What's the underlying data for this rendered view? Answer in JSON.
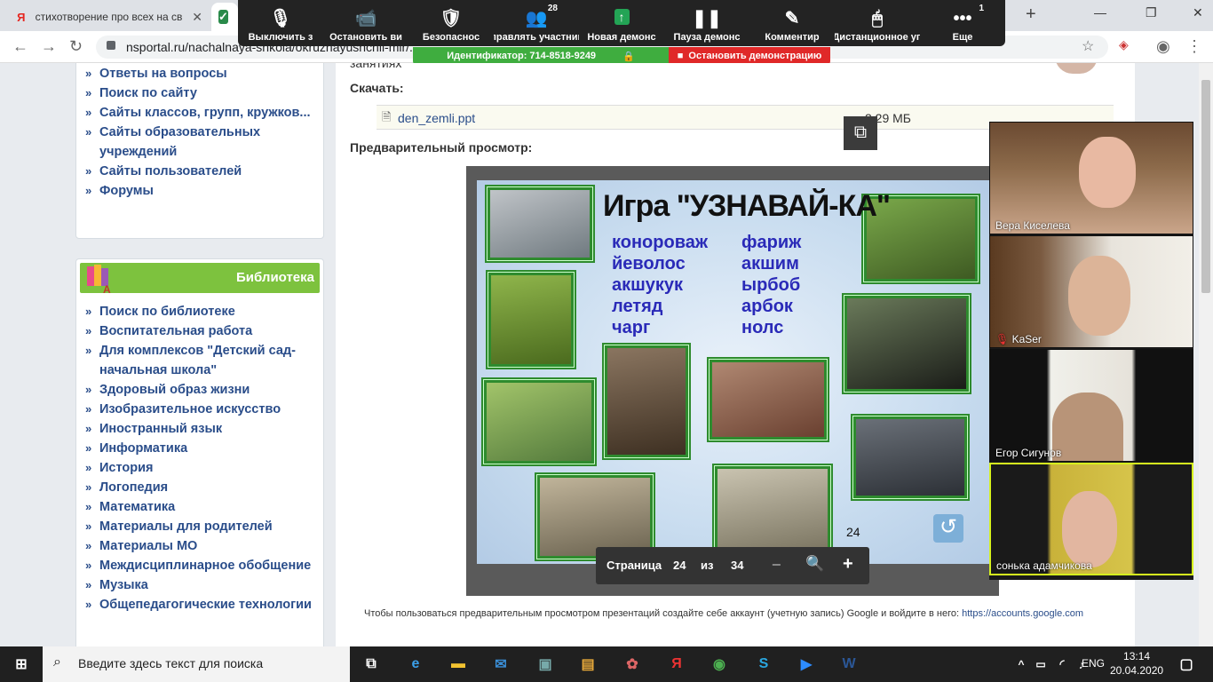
{
  "tabs": [
    {
      "title": "стихотворение про всех на св",
      "favicon": "Я",
      "color": "#e52620"
    },
    {
      "title": "",
      "favicon": "✓",
      "color": "#2a8a4a"
    }
  ],
  "window": {
    "minimize": "—",
    "maximize": "❐",
    "close": "✕",
    "new_tab": "+"
  },
  "address": {
    "url": "nsportal.ru/nachalnaya-shkola/okruzhayushchii-mir/..."
  },
  "zoom": {
    "buttons": [
      {
        "label": "Выключить з",
        "icon": "🎙",
        "badge": ""
      },
      {
        "label": "Остановить ви",
        "icon": "📹",
        "badge": ""
      },
      {
        "label": "Безопаснос",
        "icon": "🛡",
        "badge": ""
      },
      {
        "label": "Управлять участника",
        "icon": "👥",
        "badge": "28"
      },
      {
        "label": "Новая демонс",
        "icon": "↑",
        "badge": ""
      },
      {
        "label": "Пауза демонс",
        "icon": "❚❚",
        "badge": ""
      },
      {
        "label": "Комментир",
        "icon": "✎",
        "badge": ""
      },
      {
        "label": "Дистанционное уп",
        "icon": "🖱",
        "badge": ""
      },
      {
        "label": "Еще",
        "icon": "•••",
        "badge": "1"
      }
    ],
    "meeting_id": "Идентификатор: 714-8518-9249",
    "stop_share": "Остановить демонстрацию"
  },
  "sidebar": {
    "top_items": [
      "Ответы на вопросы",
      "Поиск по сайту",
      "Сайты классов, групп, кружков...",
      "Сайты образовательных учреждений",
      "Сайты пользователей",
      "Форумы"
    ],
    "library_title": "Библиотека",
    "library_items": [
      "Поиск по библиотеке",
      "Воспитательная работа",
      "Для комплексов \"Детский сад-начальная школа\"",
      "Здоровый образ жизни",
      "Изобразительное искусство",
      "Иностранный язык",
      "Информатика",
      "История",
      "Логопедия",
      "Математика",
      "Материалы для родителей",
      "Материалы МО",
      "Междисциплинарное обобщение",
      "Музыка",
      "Общепедагогические технологии"
    ]
  },
  "content": {
    "cut_text": "занятиях",
    "download_label": "Скачать:",
    "file_name": "den_zemli.ppt",
    "file_size": "2.29 МБ",
    "preview_label": "Предварительный просмотр:",
    "notice_text": "Чтобы пользоваться предварительным просмотром презентаций создайте себе аккаунт (учетную запись) Google и войдите в него: ",
    "notice_link": "https://accounts.google.com"
  },
  "slide": {
    "title": "Игра \"УЗНАВАЙ-КА\"",
    "words_left": [
      "конороваж",
      "йеволос",
      "акшукук",
      "летяд",
      "чарг"
    ],
    "words_right": [
      "фариж",
      "акшим",
      "ырбоб",
      "арбок",
      "нолс"
    ],
    "slide_number": "24"
  },
  "pager": {
    "label": "Страница",
    "current": "24",
    "of": "из",
    "total": "34"
  },
  "participants": [
    {
      "name": "Вера Киселева",
      "muted": false
    },
    {
      "name": "KaSer",
      "muted": true
    },
    {
      "name": "Егор Сигунов",
      "muted": false
    },
    {
      "name": "сонька адамчикова",
      "muted": false
    }
  ],
  "taskbar": {
    "search_placeholder": "Введите здесь текст для поиска",
    "lang": "ENG",
    "time": "13:14",
    "date": "20.04.2020"
  }
}
